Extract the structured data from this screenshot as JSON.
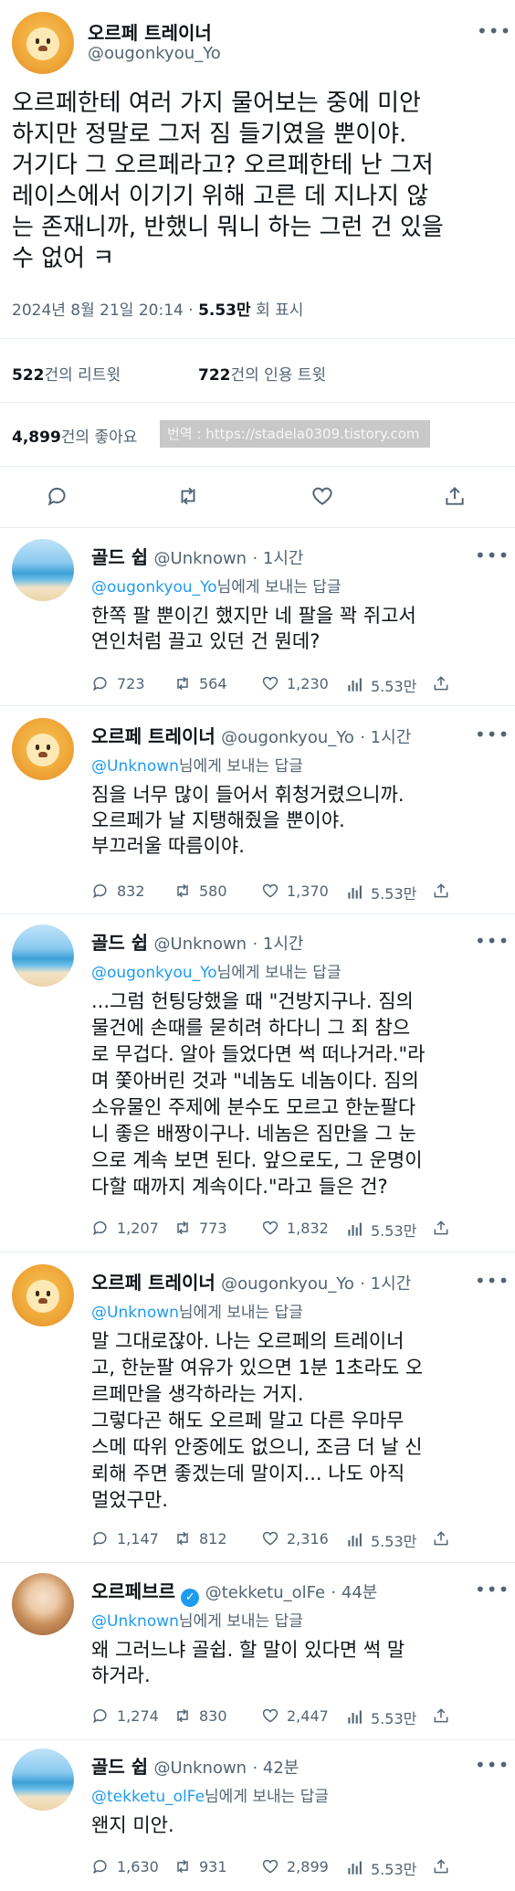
{
  "main_tweet": {
    "author_name": "오르페 트레이너",
    "author_handle": "@ougonkyou_Yo",
    "more_icon": "more-horizontal-icon",
    "text_lines": [
      "오르페한테 여러 가지 물어보는 중에 미안",
      "하지만 정말로 그저 짐 들기였을 뿐이야.",
      "거기다 그 오르페라고? 오르페한테 난 그저",
      "레이스에서 이기기 위해 고른 데 지나지 않",
      "는 존재니까, 반했니 뭐니 하는 그런 건 있을",
      "수 없어 ㅋ"
    ],
    "date": "2024년 8월 21일  20:14",
    "separator": "·",
    "views_count": "5.53만",
    "views_label": "회 표시",
    "retweets_count": "522",
    "retweets_label": "건의 리트윗",
    "quotes_count": "722",
    "quotes_label": "건의 인용 트윗",
    "likes_count": "4,899",
    "likes_label": "건의 좋아요",
    "watermark": "번역 : https://stadela0309.tistory.com"
  },
  "replies": [
    {
      "name": "골드 쉽",
      "handle": "@Unknown",
      "time": "· 1시간",
      "reply_handle": "@ougonkyou_Yo",
      "reply_suffix": "님에게 보내는 답글",
      "text_lines": [
        "한쪽 팔 뿐이긴 했지만 네 팔을 꽉 쥐고서",
        "연인처럼 끌고 있던 건 뭔데?"
      ],
      "replies": "723",
      "retweets": "564",
      "likes": "1,230",
      "views": "5.53만"
    },
    {
      "name": "오르페 트레이너",
      "handle": "@ougonkyou_Yo",
      "time": "· 1시간",
      "reply_handle": "@Unknown",
      "reply_suffix": "님에게 보내는 답글",
      "text_lines": [
        "짐을 너무 많이 들어서 휘청거렸으니까.",
        "오르페가 날 지탱해줬을 뿐이야.",
        "부끄러울 따름이야."
      ],
      "replies": "832",
      "retweets": "580",
      "likes": "1,370",
      "views": "5.53만"
    },
    {
      "name": "골드 쉽",
      "handle": "@Unknown",
      "time": "· 1시간",
      "reply_handle": "@ougonkyou_Yo",
      "reply_suffix": "님에게 보내는 답글",
      "text_lines": [
        "...그럼 헌팅당했을 때 \"건방지구나. 짐의",
        "물건에 손때를 묻히려 하다니 그 죄 참으",
        "로 무겁다. 알아 들었다면 썩 떠나거라.\"라",
        "며 쫓아버린 것과 \"네놈도 네놈이다. 짐의",
        "소유물인 주제에 분수도 모르고 한눈팔다",
        "니 좋은 배짱이구나. 네놈은 짐만을 그 눈",
        "으로 계속 보면 된다. 앞으로도, 그 운명이",
        "다할 때까지 계속이다.\"라고 들은 건?"
      ],
      "replies": "1,207",
      "retweets": "773",
      "likes": "1,832",
      "views": "5.53만"
    },
    {
      "name": "오르페 트레이너",
      "handle": "@ougonkyou_Yo",
      "time": "· 1시간",
      "reply_handle": "@Unknown",
      "reply_suffix": "님에게 보내는 답글",
      "text_lines": [
        "말 그대로잖아. 나는 오르페의 트레이너",
        "고, 한눈팔 여유가 있으면 1분 1초라도 오",
        "르페만을 생각하라는 거지.",
        "그렇다곤 해도 오르페 말고 다른 우마무",
        "스메 따위 안중에도 없으니, 조금 더 날 신",
        "뢰해 주면 좋겠는데 말이지... 나도 아직",
        "멀었구만."
      ],
      "replies": "1,147",
      "retweets": "812",
      "likes": "2,316",
      "views": "5.53만"
    },
    {
      "name": "오르페브르",
      "handle": "@tekketu_olFe",
      "time": "· 44분",
      "reply_handle": "@Unknown",
      "reply_suffix": "님에게 보내는 답글",
      "text_lines": [
        "왜 그러느냐 골쉽. 할 말이 있다면 썩 말",
        "하거라."
      ],
      "replies": "1,274",
      "retweets": "830",
      "likes": "2,447",
      "views": "5.53만"
    },
    {
      "name": "골드 쉽",
      "handle": "@Unknown",
      "time": "· 42분",
      "reply_handle": "@tekketu_olFe",
      "reply_suffix": "님에게 보내는 답글",
      "text_lines": [
        "왠지 미안."
      ],
      "replies": "1,630",
      "retweets": "931",
      "likes": "2,899",
      "views": "5.53만"
    }
  ],
  "icons": {
    "reply": "reply-icon",
    "retweet": "retweet-icon",
    "like": "heart-icon",
    "views": "views-chart-icon",
    "share": "share-icon",
    "verified": "verified-badge-icon"
  },
  "colors": {
    "text": "#0f1419",
    "muted": "#536471",
    "accent": "#1d9bf0"
  }
}
